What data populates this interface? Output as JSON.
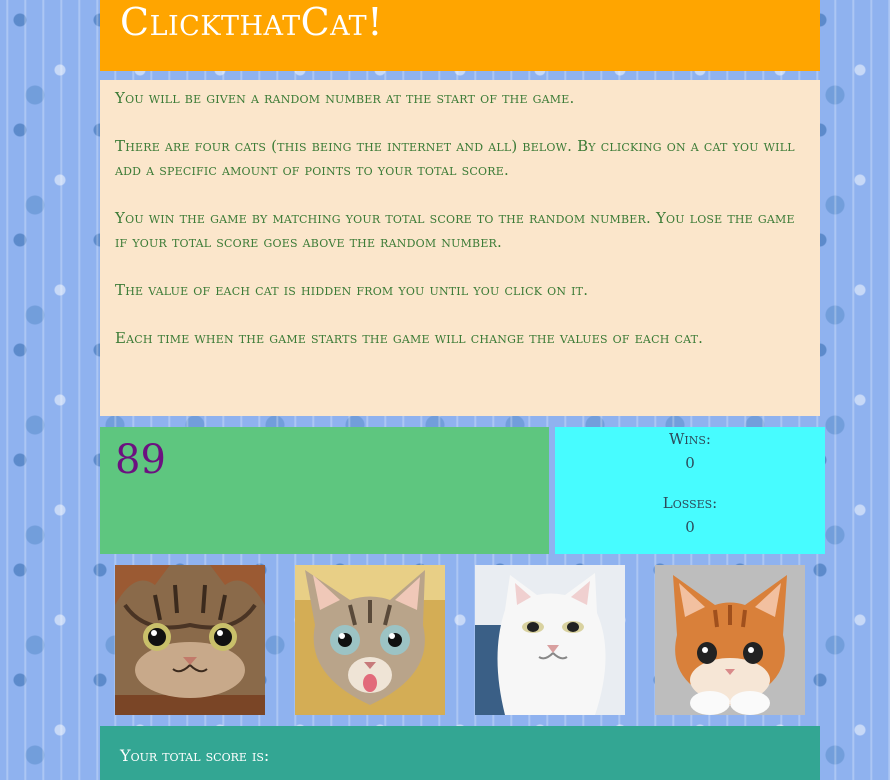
{
  "header": {
    "title": "ClickthatCat!"
  },
  "instructions": [
    "You will be given a random number at the start of the game.",
    "There are four cats (this being the internet and all) below. By clicking on a cat you will add a specific amount of points to your total score.",
    "You win the game by matching your total score to the random number. You lose the game if your total score goes above the random number.",
    "The value of each cat is hidden from you until you click on it.",
    "Each time when the game starts the game will change the values of each cat."
  ],
  "game": {
    "random_number": "89",
    "wins_label": "Wins:",
    "wins_value": "0",
    "losses_label": "Losses:",
    "losses_value": "0",
    "total_label": "Your total score is:",
    "total_value": ""
  },
  "cats": [
    {
      "icon": "tabby-cat-looking-up-icon",
      "fur": "#8a6a4a",
      "bg": "#a0603a"
    },
    {
      "icon": "grey-tabby-kitten-icon",
      "fur": "#b9a48a",
      "bg": "#d9b25c"
    },
    {
      "icon": "white-cat-icon",
      "fur": "#f2f2f2",
      "bg": "#3a5f86"
    },
    {
      "icon": "orange-kitten-icon",
      "fur": "#d9803a",
      "bg": "#b7b7b7"
    }
  ],
  "colors": {
    "header": "#ffa500",
    "instructions_bg": "#fbe6cb",
    "instructions_text": "#3b7b36",
    "target_bg": "#5ec67f",
    "target_text": "#6c1180",
    "scoreboard_bg": "#47fcff",
    "total_bg": "#33a693"
  }
}
